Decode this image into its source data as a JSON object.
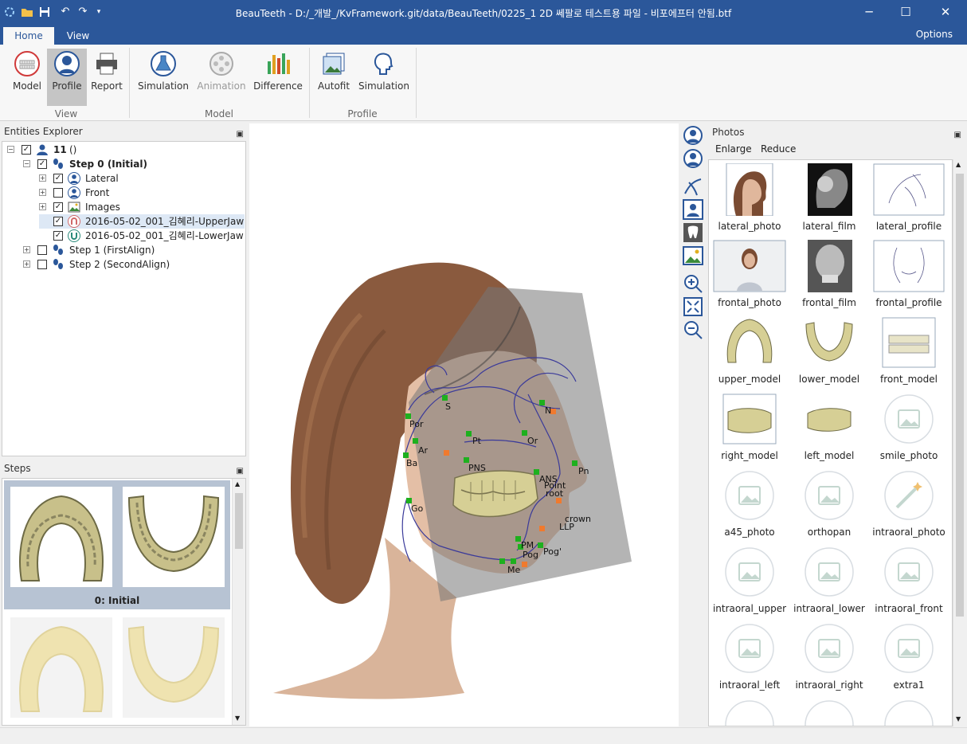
{
  "app": {
    "title": "BeauTeeth - D:/_개발_/KvFramework.git/data/BeauTeeth/0225_1 2D 쎄팔로 테스트용 파일 - 비포에프터 안됨.btf",
    "accent": "#2b579a"
  },
  "window_controls": {
    "minimize": "─",
    "maximize": "☐",
    "close": "✕"
  },
  "tabs": [
    {
      "label": "Home"
    },
    {
      "label": "View"
    }
  ],
  "options_label": "Options",
  "ribbon": {
    "buttons": [
      {
        "label": "Model",
        "icon": "teeth-icon"
      },
      {
        "label": "Profile",
        "icon": "profile-head-icon"
      },
      {
        "label": "Report",
        "icon": "printer-icon"
      },
      {
        "label": "Simulation",
        "icon": "flask-icon"
      },
      {
        "label": "Animation",
        "icon": "film-reel-icon"
      },
      {
        "label": "Difference",
        "icon": "bar-chart-icon"
      },
      {
        "label": "Autofit",
        "icon": "photos-stack-icon"
      },
      {
        "label": "Simulation",
        "icon": "head-outline-icon"
      }
    ],
    "groups": [
      "View",
      "Model",
      "Profile"
    ]
  },
  "entities": {
    "title": "Entities Explorer",
    "root": {
      "label": "11",
      "suffix": "()"
    },
    "step0": {
      "label": "Step 0 (Initial)"
    },
    "children": [
      {
        "label": "Lateral",
        "icon": "person-icon"
      },
      {
        "label": "Front",
        "icon": "person-icon"
      },
      {
        "label": "Images",
        "icon": "image-icon"
      },
      {
        "label": "2016-05-02_001_김혜리-UpperJaw",
        "icon": "upper-jaw-icon"
      },
      {
        "label": "2016-05-02_001_김혜리-LowerJaw",
        "icon": "lower-jaw-icon"
      }
    ],
    "step1": {
      "label": "Step 1 (FirstAlign)"
    },
    "step2": {
      "label": "Step 2 (SecondAlign)"
    }
  },
  "steps": {
    "title": "Steps",
    "items": [
      {
        "label": "0: Initial"
      }
    ]
  },
  "landmarks": [
    {
      "label": "S"
    },
    {
      "label": "Por"
    },
    {
      "label": "N"
    },
    {
      "label": "Pt"
    },
    {
      "label": "Or"
    },
    {
      "label": "Ar"
    },
    {
      "label": "Ba"
    },
    {
      "label": "PNS"
    },
    {
      "label": "Pn"
    },
    {
      "label": "ANS"
    },
    {
      "label": "Point"
    },
    {
      "label": "root"
    },
    {
      "label": "crown"
    },
    {
      "label": "LLP"
    },
    {
      "label": "Go"
    },
    {
      "label": "PM"
    },
    {
      "label": "Pog"
    },
    {
      "label": "Pog'"
    },
    {
      "label": "Me"
    }
  ],
  "vtoolbar": [
    "profile-lateral-icon",
    "profile-front-icon",
    "curve-tool-icon",
    "portrait-icon",
    "tooth-icon",
    "image-icon",
    "zoom-in-icon",
    "fit-icon",
    "zoom-out-icon"
  ],
  "photos": {
    "title": "Photos",
    "enlarge": "Enlarge",
    "reduce": "Reduce",
    "items": [
      {
        "label": "lateral_photo"
      },
      {
        "label": "lateral_film"
      },
      {
        "label": "lateral_profile"
      },
      {
        "label": "frontal_photo"
      },
      {
        "label": "frontal_film"
      },
      {
        "label": "frontal_profile"
      },
      {
        "label": "upper_model"
      },
      {
        "label": "lower_model"
      },
      {
        "label": "front_model"
      },
      {
        "label": "right_model"
      },
      {
        "label": "left_model"
      },
      {
        "label": "smile_photo"
      },
      {
        "label": "a45_photo"
      },
      {
        "label": "orthopan"
      },
      {
        "label": "intraoral_photo"
      },
      {
        "label": "intraoral_upper"
      },
      {
        "label": "intraoral_lower"
      },
      {
        "label": "intraoral_front"
      },
      {
        "label": "intraoral_left"
      },
      {
        "label": "intraoral_right"
      },
      {
        "label": "extra1"
      }
    ]
  }
}
